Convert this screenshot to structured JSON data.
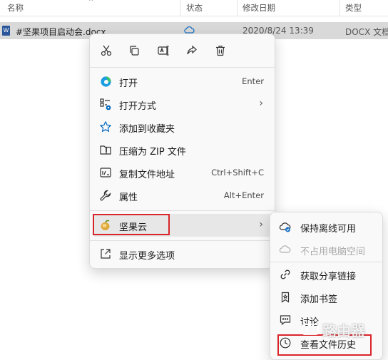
{
  "columns": {
    "name": "名称",
    "status": "状态",
    "modified": "修改日期",
    "type": "类型"
  },
  "file": {
    "name": "#坚果项目启动会.docx",
    "modified": "2020/8/24 13:39",
    "type": "DOCX 文档"
  },
  "quick_actions": [
    "cut-icon",
    "copy-icon",
    "rename-icon",
    "share-icon",
    "delete-icon"
  ],
  "menu": {
    "open": {
      "label": "打开",
      "shortcut": "Enter"
    },
    "open_with": {
      "label": "打开方式"
    },
    "favorites": {
      "label": "添加到收藏夹"
    },
    "zip": {
      "label": "压缩为 ZIP 文件"
    },
    "copy_path": {
      "label": "复制文件地址",
      "shortcut": "Ctrl+Shift+C"
    },
    "properties": {
      "label": "属性",
      "shortcut": "Alt+Enter"
    },
    "jianguoyun": {
      "label": "坚果云"
    },
    "more_options": {
      "label": "显示更多选项"
    }
  },
  "submenu": {
    "keep_offline": "保持离线可用",
    "free_space": "不占用电脑空间",
    "share_link": "获取分享链接",
    "bookmark": "添加书签",
    "discuss": "讨论",
    "history": "查看文件历史"
  },
  "watermark": {
    "text": "路由器"
  },
  "colors": {
    "accent": "#0067c0",
    "highlight_border": "#d9252a",
    "selected_row": "#d9d9d9"
  }
}
